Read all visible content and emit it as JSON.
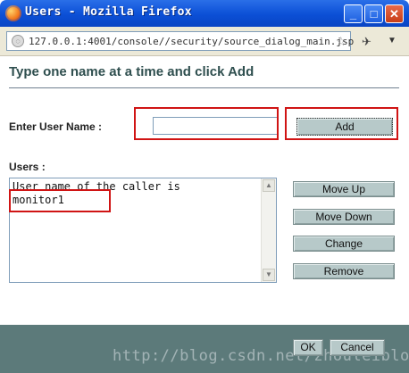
{
  "window": {
    "title": "Users - Mozilla Firefox",
    "buttons": {
      "minimize": "_",
      "maximize": "□",
      "close": "✕"
    }
  },
  "urlbar": {
    "url": "127.0.0.1:4001/console//security/source_dialog_main.jsp",
    "site_icon": "globe-icon",
    "bookmark_icon": "star-icon"
  },
  "dialog": {
    "heading": "Type one name at a time and click Add",
    "username_label": "Enter User Name :",
    "username_value": "",
    "add_label": "Add",
    "users_label": "Users :",
    "users_lines": [
      "User name of the caller is",
      "monitor1"
    ],
    "buttons": {
      "move_up": "Move Up",
      "move_down": "Move Down",
      "change": "Change",
      "remove": "Remove"
    },
    "footer": {
      "ok": "OK",
      "cancel": "Cancel"
    }
  },
  "watermark": "http://blog.csdn.net/zhouleiblog",
  "colors": {
    "title_bar": "#0b4fd6",
    "heading": "#2f4f4f",
    "button": "#b7c9c9",
    "footer": "#5c7a7a",
    "highlight": "#d01414"
  }
}
